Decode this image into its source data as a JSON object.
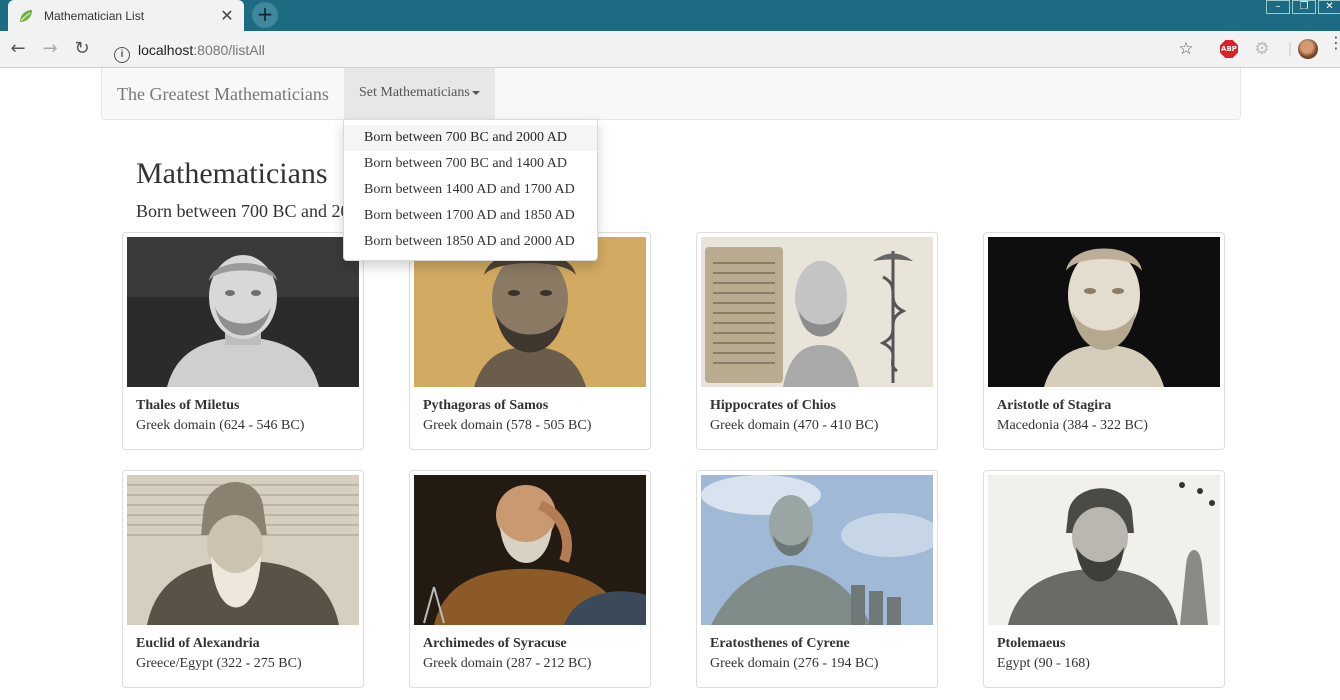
{
  "browser": {
    "tab_title": "Mathematician List",
    "tab_close": "✕",
    "new_tab": "+",
    "url_host": "localhost",
    "url_rest": ":8080/listAll"
  },
  "navbar": {
    "brand": "The Greatest Mathematicians",
    "dropdown_label": "Set Mathematicians"
  },
  "dropdown": {
    "items": [
      "Born between 700 BC and 2000 AD",
      "Born between 700 BC and 1400 AD",
      "Born between 1400 AD and 1700 AD",
      "Born between 1700 AD and 1850 AD",
      "Born between 1850 AD and 2000 AD"
    ]
  },
  "main": {
    "title": "Mathematicians",
    "subtitle": "Born between 700 BC and 2000 AD"
  },
  "cards": [
    {
      "name": "Thales of Miletus",
      "origin": "Greek domain (624 - 546 BC)"
    },
    {
      "name": "Pythagoras of Samos",
      "origin": "Greek domain (578 - 505 BC)"
    },
    {
      "name": "Hippocrates of Chios",
      "origin": "Greek domain (470 - 410 BC)"
    },
    {
      "name": "Aristotle of Stagira",
      "origin": "Macedonia (384 - 322 BC)"
    },
    {
      "name": "Euclid of Alexandria",
      "origin": "Greece/Egypt (322 - 275 BC)"
    },
    {
      "name": "Archimedes of Syracuse",
      "origin": "Greek domain (287 - 212 BC)"
    },
    {
      "name": "Eratosthenes of Cyrene",
      "origin": "Greek domain (276 - 194 BC)"
    },
    {
      "name": "Ptolemaeus",
      "origin": "Egypt (90 - 168)"
    }
  ],
  "colors": {
    "titlebar": "#1d6b82",
    "navbar_bg": "#f8f8f8",
    "dropdown_toggle_bg": "#e7e7e7",
    "card_border": "#dddddd"
  }
}
